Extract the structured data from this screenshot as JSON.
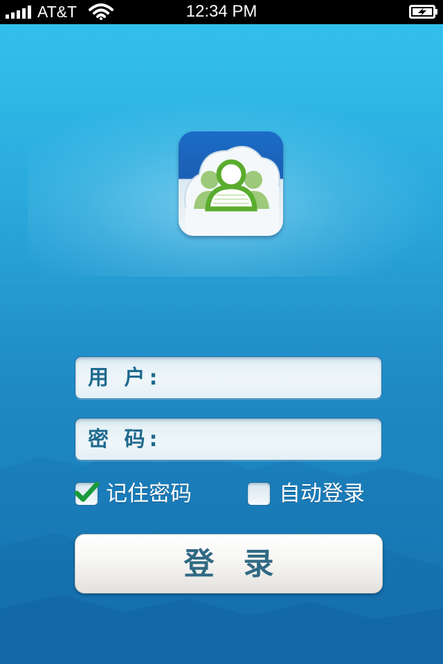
{
  "status_bar": {
    "carrier": "AT&T",
    "time": "12:34 PM",
    "signal_icon": "cellular-signal-icon",
    "wifi_icon": "wifi-icon",
    "battery_icon": "battery-charging-icon"
  },
  "app": {
    "logo_icon": "cloud-contacts-logo-icon"
  },
  "login_form": {
    "username": {
      "label": "用 户",
      "colon": ":",
      "value": ""
    },
    "password": {
      "label": "密 码",
      "colon": ":",
      "value": ""
    },
    "remember_password": {
      "label": "记住密码",
      "checked": true
    },
    "auto_login": {
      "label": "自动登录",
      "checked": false
    },
    "login_button": "登录"
  },
  "colors": {
    "background_top": "#34c3ee",
    "background_bottom": "#1577b2",
    "label_text": "#1f6a8e",
    "checkmark": "#1a9a3c"
  }
}
